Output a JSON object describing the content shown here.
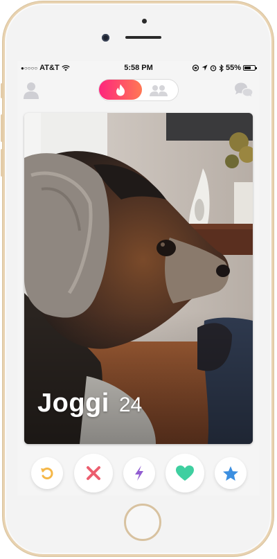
{
  "status_bar": {
    "carrier": "AT&T",
    "time": "5:58 PM",
    "battery": "55%"
  },
  "header": {
    "left_icon": "profile-icon",
    "toggle_active": "flame-icon",
    "toggle_inactive": "group-icon",
    "right_icon": "chat-icon"
  },
  "card": {
    "name": "Joggi",
    "age": "24"
  },
  "actions": [
    {
      "icon": "rewind-icon",
      "color": "#f5b748"
    },
    {
      "icon": "nope-icon",
      "color": "#ec5e6f"
    },
    {
      "icon": "boost-icon",
      "color": "#915dd1"
    },
    {
      "icon": "like-icon",
      "color": "#3fcfa0"
    },
    {
      "icon": "super-like-icon",
      "color": "#3c8fe0"
    }
  ],
  "colors": {
    "brand_gradient_start": "#fd267d",
    "brand_gradient_end": "#ff7854",
    "frame_gold": "#e8d2b0"
  }
}
